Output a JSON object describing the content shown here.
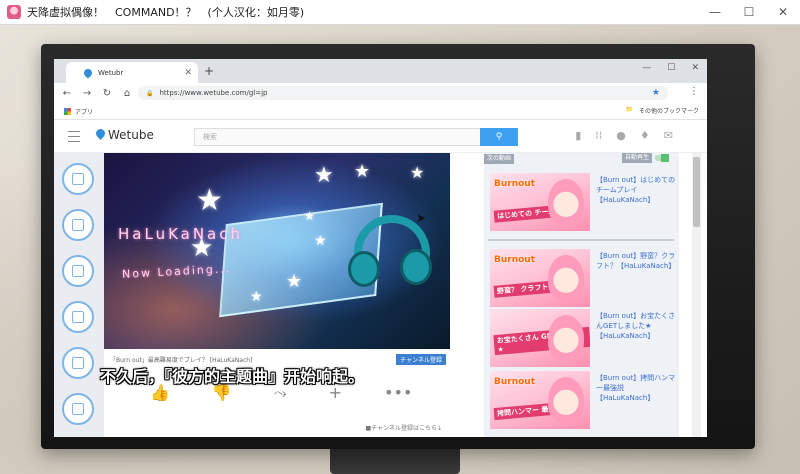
{
  "window": {
    "title": "天降虚拟偶像！　COMMAND！？　(个人汉化：如月零)",
    "minimize": "—",
    "maximize": "☐",
    "close": "✕"
  },
  "browser": {
    "tab_title": "Wetubr",
    "tab_close": "✕",
    "new_tab": "+",
    "win_min": "—",
    "win_max": "☐",
    "win_close": "✕",
    "back": "←",
    "forward": "→",
    "reload": "↻",
    "home": "⌂",
    "url": "https://www.wetube.com/gl=jp",
    "bookmark_star": "★",
    "menu": "⋮",
    "bookmarks_apps": "アプリ",
    "other_bookmarks": "その他のブックマーク"
  },
  "site": {
    "logo": "Wetube",
    "search_placeholder": "検索",
    "search_button": "⚲"
  },
  "video": {
    "overlay_title": "HaLuKaNach",
    "overlay_subtitle": "Now Loading...",
    "info_line": "「Burn out」最高難易度でプレイ？ [HaLuKaNach]",
    "subscribe_label": "チャンネル登録",
    "actions": [
      "👍",
      "👎",
      "⤳",
      "+",
      "•••"
    ],
    "sub_note": "■チャンネル登録はこちら↓"
  },
  "subtitle": "不久后，『彼方的主题曲』开始响起。",
  "recommend": {
    "next_label": "次の動画",
    "autoplay_label": "自動再生",
    "items": [
      {
        "title": "【Burn out】はじめてのチームプレイ【HaLuKaNach】",
        "thumb_caption": "はじめての チームプレイ"
      },
      {
        "title": "【Burn out】野蛮？クラフト？【HaLuKaNach】",
        "thumb_caption": "野蛮？ クラフト？"
      },
      {
        "title": "【Burn out】お宝たくさんGETしました★【HaLuKaNach】",
        "thumb_caption": "お宝たくさん GETしました★"
      },
      {
        "title": "【Burn out】拷問ハンマー最強説【HaLuKaNach】",
        "thumb_caption": "拷問ハンマー 最強説"
      }
    ],
    "thumb_brand": "Burnout"
  }
}
